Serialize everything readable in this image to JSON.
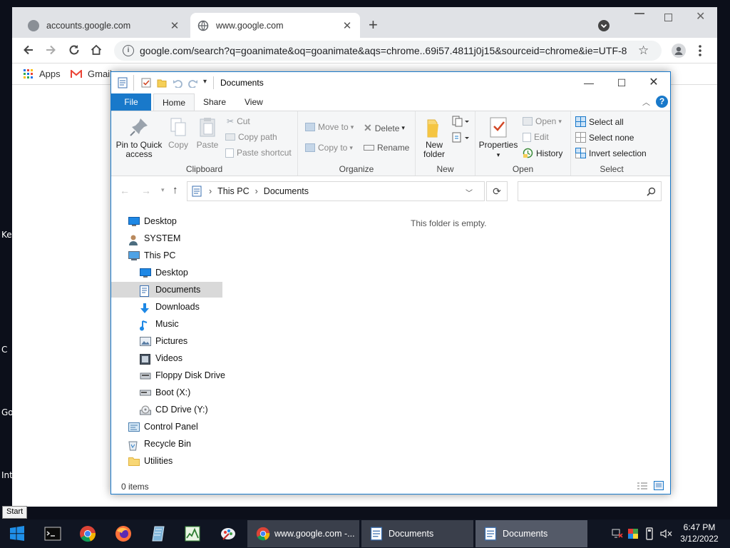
{
  "desktop": {
    "labels": [
      "Key",
      "C",
      "Go",
      "Inte"
    ]
  },
  "chrome": {
    "tabs": [
      {
        "title": "accounts.google.com",
        "active": false
      },
      {
        "title": "www.google.com",
        "active": true
      }
    ],
    "new_tab": "+",
    "url": "google.com/search?q=goanimate&oq=goanimate&aqs=chrome..69i57.4811j0j15&sourceid=chrome&ie=UTF-8",
    "bookmarks": {
      "apps": "Apps",
      "gmail": "Gmail"
    },
    "colors": {
      "tabbar": "#e0e2e6",
      "accent": "#1a73e8"
    }
  },
  "explorer": {
    "title": "Documents",
    "tabs": {
      "file": "File",
      "home": "Home",
      "share": "Share",
      "view": "View"
    },
    "ribbon": {
      "clipboard": {
        "label": "Clipboard",
        "pin": "Pin to Quick access",
        "pin_line1": "Pin to Quick",
        "pin_line2": "access",
        "copy": "Copy",
        "paste": "Paste",
        "cut": "Cut",
        "copy_path": "Copy path",
        "paste_shortcut": "Paste shortcut"
      },
      "organize": {
        "label": "Organize",
        "move_to": "Move to",
        "copy_to": "Copy to",
        "delete": "Delete",
        "rename": "Rename"
      },
      "new": {
        "label": "New",
        "new_folder_line1": "New",
        "new_folder_line2": "folder"
      },
      "open": {
        "label": "Open",
        "properties": "Properties",
        "open": "Open",
        "edit": "Edit",
        "history": "History"
      },
      "select": {
        "label": "Select",
        "select_all": "Select all",
        "select_none": "Select none",
        "invert": "Invert selection"
      }
    },
    "address": {
      "crumbs": [
        "This PC",
        "Documents"
      ]
    },
    "search_placeholder": "",
    "nav": [
      {
        "label": "Desktop",
        "icon": "desktop-icon",
        "indent": 0,
        "selected": false
      },
      {
        "label": "SYSTEM",
        "icon": "user-icon",
        "indent": 0,
        "selected": false
      },
      {
        "label": "This PC",
        "icon": "computer-icon",
        "indent": 0,
        "selected": false
      },
      {
        "label": "Desktop",
        "icon": "desktop-icon",
        "indent": 1,
        "selected": false
      },
      {
        "label": "Documents",
        "icon": "documents-icon",
        "indent": 1,
        "selected": true
      },
      {
        "label": "Downloads",
        "icon": "download-icon",
        "indent": 1,
        "selected": false
      },
      {
        "label": "Music",
        "icon": "music-icon",
        "indent": 1,
        "selected": false
      },
      {
        "label": "Pictures",
        "icon": "pictures-icon",
        "indent": 1,
        "selected": false
      },
      {
        "label": "Videos",
        "icon": "videos-icon",
        "indent": 1,
        "selected": false
      },
      {
        "label": "Floppy Disk Drive",
        "icon": "floppy-icon",
        "indent": 1,
        "selected": false
      },
      {
        "label": "Boot (X:)",
        "icon": "drive-icon",
        "indent": 1,
        "selected": false
      },
      {
        "label": "CD Drive (Y:)",
        "icon": "cd-icon",
        "indent": 1,
        "selected": false
      },
      {
        "label": "Control Panel",
        "icon": "control-panel-icon",
        "indent": 0,
        "selected": false
      },
      {
        "label": "Recycle Bin",
        "icon": "recycle-bin-icon",
        "indent": 0,
        "selected": false
      },
      {
        "label": "Utilities",
        "icon": "folder-icon",
        "indent": 0,
        "selected": false
      }
    ],
    "empty_message": "This folder is empty.",
    "status": "0 items",
    "colors": {
      "accent": "#1979ca"
    }
  },
  "taskbar": {
    "start_tooltip": "Start",
    "tasks": [
      {
        "label": "www.google.com -...",
        "icon": "chrome-icon",
        "active": false
      },
      {
        "label": "Documents",
        "icon": "explorer-icon",
        "active": false
      },
      {
        "label": "Documents",
        "icon": "explorer-icon",
        "active": true
      }
    ],
    "time": "6:47 PM",
    "date": "3/12/2022"
  }
}
